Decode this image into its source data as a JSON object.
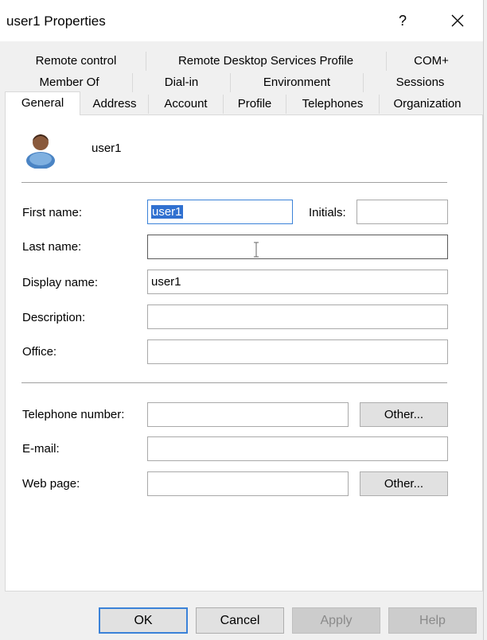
{
  "window": {
    "title": "user1 Properties",
    "help_label": "?"
  },
  "tabs": {
    "row1": [
      "Remote control",
      "Remote Desktop Services Profile",
      "COM+"
    ],
    "row2": [
      "Member Of",
      "Dial-in",
      "Environment",
      "Sessions"
    ],
    "row3": [
      "General",
      "Address",
      "Account",
      "Profile",
      "Telephones",
      "Organization"
    ],
    "active": "General"
  },
  "general": {
    "user_name": "user1",
    "first_name": {
      "label": "First name:",
      "value": "user1"
    },
    "initials": {
      "label": "Initials:",
      "value": ""
    },
    "last_name": {
      "label": "Last name:",
      "value": ""
    },
    "display_name": {
      "label": "Display name:",
      "value": "user1"
    },
    "description": {
      "label": "Description:",
      "value": ""
    },
    "office": {
      "label": "Office:",
      "value": ""
    },
    "telephone": {
      "label": "Telephone number:",
      "value": "",
      "other_label": "Other..."
    },
    "email": {
      "label": "E-mail:",
      "value": ""
    },
    "web_page": {
      "label": "Web page:",
      "value": "",
      "other_label": "Other..."
    }
  },
  "footer": {
    "ok": "OK",
    "cancel": "Cancel",
    "apply": "Apply",
    "help": "Help"
  },
  "colors": {
    "accent": "#3b82d8",
    "selection": "#3070d0"
  },
  "icons": {
    "user": "user-avatar-icon",
    "close": "close-icon",
    "text_cursor": "ibeam-cursor-icon"
  }
}
